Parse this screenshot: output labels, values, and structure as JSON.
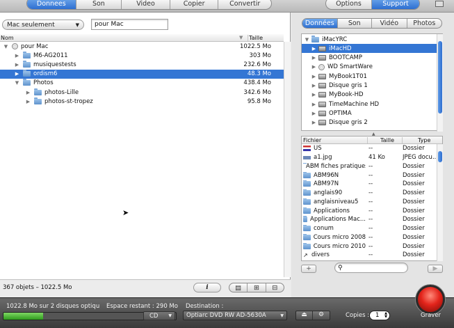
{
  "top_tabs_left": [
    "Donnees",
    "Son",
    "Video",
    "Copier",
    "Convertir"
  ],
  "top_tabs_right": [
    "Options",
    "Support"
  ],
  "left": {
    "filter_select": "Mac seulement",
    "search_value": "pour Mac",
    "col_name": "Nom",
    "col_size": "Taille",
    "tree": [
      {
        "label": "pour Mac",
        "size": "1022.5 Mo",
        "indent": 0,
        "tri": "▼",
        "icon": "disc"
      },
      {
        "label": "M6-AG2011",
        "size": "303 Mo",
        "indent": 1,
        "tri": "▶",
        "icon": "folder"
      },
      {
        "label": "musiquestests",
        "size": "232.6 Mo",
        "indent": 1,
        "tri": "▶",
        "icon": "folder"
      },
      {
        "label": "ordism6",
        "size": "48.3 Mo",
        "indent": 1,
        "tri": "▶",
        "icon": "folder",
        "selected": true
      },
      {
        "label": "Photos",
        "size": "438.4 Mo",
        "indent": 1,
        "tri": "▼",
        "icon": "folder"
      },
      {
        "label": "photos-Lille",
        "size": "342.6 Mo",
        "indent": 2,
        "tri": "▶",
        "icon": "folder"
      },
      {
        "label": "photos-st-tropez",
        "size": "95.8 Mo",
        "indent": 2,
        "tri": "▶",
        "icon": "folder"
      }
    ],
    "status": "367 objets – 1022.5 Mo",
    "info_btn": "i"
  },
  "right": {
    "tabs": [
      "Données",
      "Son",
      "Vidéo",
      "Photos"
    ],
    "volumes": [
      {
        "label": "iMacYRC",
        "tri": "▼",
        "indent": 0,
        "icon": "folder"
      },
      {
        "label": "iMacHD",
        "tri": "▶",
        "indent": 1,
        "icon": "drive",
        "selected": true
      },
      {
        "label": "BOOTCAMP",
        "tri": "▶",
        "indent": 1,
        "icon": "drive"
      },
      {
        "label": "WD SmartWare",
        "tri": "▶",
        "indent": 1,
        "icon": "disc"
      },
      {
        "label": "MyBook1T01",
        "tri": "▶",
        "indent": 1,
        "icon": "drive"
      },
      {
        "label": "Disque gris 1",
        "tri": "▶",
        "indent": 1,
        "icon": "drive"
      },
      {
        "label": "MyBook-HD",
        "tri": "▶",
        "indent": 1,
        "icon": "drive"
      },
      {
        "label": "TimeMachine HD",
        "tri": "▶",
        "indent": 1,
        "icon": "drive"
      },
      {
        "label": "OPTIMA",
        "tri": "▶",
        "indent": 1,
        "icon": "drive"
      },
      {
        "label": "Disque gris 2",
        "tri": "▶",
        "indent": 1,
        "icon": "drive"
      }
    ],
    "file_cols": [
      "Fichier",
      "Taille",
      "Type"
    ],
    "files": [
      {
        "name": "US",
        "size": "--",
        "type": "Dossier",
        "icon": "flag"
      },
      {
        "name": "a1.jpg",
        "size": "41 Ko",
        "type": "JPEG docu...",
        "icon": "file"
      },
      {
        "name": "ABM fiches pratiques",
        "size": "--",
        "type": "Dossier",
        "icon": "folder"
      },
      {
        "name": "ABM96N",
        "size": "--",
        "type": "Dossier",
        "icon": "folder"
      },
      {
        "name": "ABM97N",
        "size": "--",
        "type": "Dossier",
        "icon": "folder"
      },
      {
        "name": "anglais90",
        "size": "--",
        "type": "Dossier",
        "icon": "folder"
      },
      {
        "name": "anglaisniveau5",
        "size": "--",
        "type": "Dossier",
        "icon": "folder"
      },
      {
        "name": "Applications",
        "size": "--",
        "type": "Dossier",
        "icon": "folder"
      },
      {
        "name": "Applications Mac...",
        "size": "--",
        "type": "Dossier",
        "icon": "folder"
      },
      {
        "name": "conum",
        "size": "--",
        "type": "Dossier",
        "icon": "folder"
      },
      {
        "name": "Cours micro 2008",
        "size": "--",
        "type": "Dossier",
        "icon": "folder"
      },
      {
        "name": "Cours micro 2010",
        "size": "--",
        "type": "Dossier",
        "icon": "folder"
      },
      {
        "name": "divers",
        "size": "--",
        "type": "Dossier",
        "icon": "alias"
      }
    ]
  },
  "bottom": {
    "capacity_text": "1022.8 Mo sur 2 disques optiqu",
    "space_text": "Espace restant : 290 Mo",
    "media_select": "CD",
    "dest_label": "Destination :",
    "dest_value": "Optiarc DVD RW AD-5630A",
    "copies_label": "Copies :",
    "copies_value": "1",
    "burn_label": "Graver",
    "progress_fraction": 0.23
  }
}
